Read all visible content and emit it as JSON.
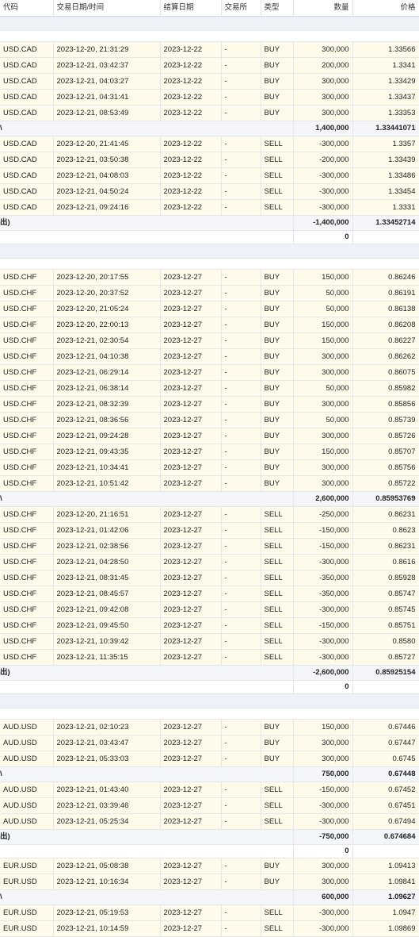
{
  "headers": [
    "代码",
    "交易日期/时间",
    "结算日期",
    "交易所",
    "类型",
    "数量",
    "价格"
  ],
  "groups": [
    {
      "buy_trades": [
        [
          "USD.CAD",
          "2023-12-20, 21:31:29",
          "2023-12-22",
          "-",
          "BUY",
          "300,000",
          "1.33566"
        ],
        [
          "USD.CAD",
          "2023-12-21, 03:42:37",
          "2023-12-22",
          "-",
          "BUY",
          "200,000",
          "1.3341"
        ],
        [
          "USD.CAD",
          "2023-12-21, 04:03:27",
          "2023-12-22",
          "-",
          "BUY",
          "300,000",
          "1.33429"
        ],
        [
          "USD.CAD",
          "2023-12-21, 04:31:41",
          "2023-12-22",
          "-",
          "BUY",
          "300,000",
          "1.33437"
        ],
        [
          "USD.CAD",
          "2023-12-21, 08:53:49",
          "2023-12-22",
          "-",
          "BUY",
          "300,000",
          "1.33353"
        ]
      ],
      "buy_total": {
        "label": "\\",
        "qty": "1,400,000",
        "price": "1.33441071"
      },
      "sell_trades": [
        [
          "USD.CAD",
          "2023-12-20, 21:41:45",
          "2023-12-22",
          "-",
          "SELL",
          "-300,000",
          "1.3357"
        ],
        [
          "USD.CAD",
          "2023-12-21, 03:50:38",
          "2023-12-22",
          "-",
          "SELL",
          "-200,000",
          "1.33439"
        ],
        [
          "USD.CAD",
          "2023-12-21, 04:08:03",
          "2023-12-22",
          "-",
          "SELL",
          "-300,000",
          "1.33486"
        ],
        [
          "USD.CAD",
          "2023-12-21, 04:50:24",
          "2023-12-22",
          "-",
          "SELL",
          "-300,000",
          "1.33454"
        ],
        [
          "USD.CAD",
          "2023-12-21, 09:24:16",
          "2023-12-22",
          "-",
          "SELL",
          "-300,000",
          "1.3331"
        ]
      ],
      "sell_total": {
        "label": "出)",
        "qty": "-1,400,000",
        "price": "1.33452714"
      },
      "net": "0"
    },
    {
      "buy_trades": [
        [
          "USD.CHF",
          "2023-12-20, 20:17:55",
          "2023-12-27",
          "-",
          "BUY",
          "150,000",
          "0.86246"
        ],
        [
          "USD.CHF",
          "2023-12-20, 20:37:52",
          "2023-12-27",
          "-",
          "BUY",
          "50,000",
          "0.86191"
        ],
        [
          "USD.CHF",
          "2023-12-20, 21:05:24",
          "2023-12-27",
          "-",
          "BUY",
          "50,000",
          "0.86138"
        ],
        [
          "USD.CHF",
          "2023-12-20, 22:00:13",
          "2023-12-27",
          "-",
          "BUY",
          "150,000",
          "0.86208"
        ],
        [
          "USD.CHF",
          "2023-12-21, 02:30:54",
          "2023-12-27",
          "-",
          "BUY",
          "150,000",
          "0.86227"
        ],
        [
          "USD.CHF",
          "2023-12-21, 04:10:38",
          "2023-12-27",
          "-",
          "BUY",
          "300,000",
          "0.86262"
        ],
        [
          "USD.CHF",
          "2023-12-21, 06:29:14",
          "2023-12-27",
          "-",
          "BUY",
          "300,000",
          "0.86075"
        ],
        [
          "USD.CHF",
          "2023-12-21, 06:38:14",
          "2023-12-27",
          "-",
          "BUY",
          "50,000",
          "0.85982"
        ],
        [
          "USD.CHF",
          "2023-12-21, 08:32:39",
          "2023-12-27",
          "-",
          "BUY",
          "300,000",
          "0.85856"
        ],
        [
          "USD.CHF",
          "2023-12-21, 08:36:56",
          "2023-12-27",
          "-",
          "BUY",
          "50,000",
          "0.85739"
        ],
        [
          "USD.CHF",
          "2023-12-21, 09:24:28",
          "2023-12-27",
          "-",
          "BUY",
          "300,000",
          "0.85726"
        ],
        [
          "USD.CHF",
          "2023-12-21, 09:43:35",
          "2023-12-27",
          "-",
          "BUY",
          "150,000",
          "0.85707"
        ],
        [
          "USD.CHF",
          "2023-12-21, 10:34:41",
          "2023-12-27",
          "-",
          "BUY",
          "300,000",
          "0.85756"
        ],
        [
          "USD.CHF",
          "2023-12-21, 10:51:42",
          "2023-12-27",
          "-",
          "BUY",
          "300,000",
          "0.85722"
        ]
      ],
      "buy_total": {
        "label": "\\",
        "qty": "2,600,000",
        "price": "0.85953769"
      },
      "sell_trades": [
        [
          "USD.CHF",
          "2023-12-20, 21:16:51",
          "2023-12-27",
          "-",
          "SELL",
          "-250,000",
          "0.86231"
        ],
        [
          "USD.CHF",
          "2023-12-21, 01:42:06",
          "2023-12-27",
          "-",
          "SELL",
          "-150,000",
          "0.8623"
        ],
        [
          "USD.CHF",
          "2023-12-21, 02:38:56",
          "2023-12-27",
          "-",
          "SELL",
          "-150,000",
          "0.86231"
        ],
        [
          "USD.CHF",
          "2023-12-21, 04:28:50",
          "2023-12-27",
          "-",
          "SELL",
          "-300,000",
          "0.8616"
        ],
        [
          "USD.CHF",
          "2023-12-21, 08:31:45",
          "2023-12-27",
          "-",
          "SELL",
          "-350,000",
          "0.85928"
        ],
        [
          "USD.CHF",
          "2023-12-21, 08:45:57",
          "2023-12-27",
          "-",
          "SELL",
          "-350,000",
          "0.85747"
        ],
        [
          "USD.CHF",
          "2023-12-21, 09:42:08",
          "2023-12-27",
          "-",
          "SELL",
          "-300,000",
          "0.85745"
        ],
        [
          "USD.CHF",
          "2023-12-21, 09:45:50",
          "2023-12-27",
          "-",
          "SELL",
          "-150,000",
          "0.85751"
        ],
        [
          "USD.CHF",
          "2023-12-21, 10:39:42",
          "2023-12-27",
          "-",
          "SELL",
          "-300,000",
          "0.8580"
        ],
        [
          "USD.CHF",
          "2023-12-21, 11:35:15",
          "2023-12-27",
          "-",
          "SELL",
          "-300,000",
          "0.85727"
        ]
      ],
      "sell_total": {
        "label": "出)",
        "qty": "-2,600,000",
        "price": "0.85925154"
      },
      "net": "0"
    },
    {
      "buy_trades": [
        [
          "AUD.USD",
          "2023-12-21, 02:10:23",
          "2023-12-27",
          "-",
          "BUY",
          "150,000",
          "0.67446"
        ],
        [
          "AUD.USD",
          "2023-12-21, 03:43:47",
          "2023-12-27",
          "-",
          "BUY",
          "300,000",
          "0.67447"
        ],
        [
          "AUD.USD",
          "2023-12-21, 05:33:03",
          "2023-12-27",
          "-",
          "BUY",
          "300,000",
          "0.6745"
        ]
      ],
      "buy_total": {
        "label": "\\",
        "qty": "750,000",
        "price": "0.67448"
      },
      "sell_trades": [
        [
          "AUD.USD",
          "2023-12-21, 01:43:40",
          "2023-12-27",
          "-",
          "SELL",
          "-150,000",
          "0.67452"
        ],
        [
          "AUD.USD",
          "2023-12-21, 03:39:46",
          "2023-12-27",
          "-",
          "SELL",
          "-300,000",
          "0.67451"
        ],
        [
          "AUD.USD",
          "2023-12-21, 05:25:34",
          "2023-12-27",
          "-",
          "SELL",
          "-300,000",
          "0.67494"
        ]
      ],
      "sell_total": {
        "label": "出)",
        "qty": "-750,000",
        "price": "0.674684"
      },
      "net": "0"
    },
    {
      "buy_trades": [
        [
          "EUR.USD",
          "2023-12-21, 05:08:38",
          "2023-12-27",
          "-",
          "BUY",
          "300,000",
          "1.09413"
        ],
        [
          "EUR.USD",
          "2023-12-21, 10:16:34",
          "2023-12-27",
          "-",
          "BUY",
          "300,000",
          "1.09841"
        ]
      ],
      "buy_total": {
        "label": "\\",
        "qty": "600,000",
        "price": "1.09627"
      },
      "sell_trades": [
        [
          "EUR.USD",
          "2023-12-21, 05:19:53",
          "2023-12-27",
          "-",
          "SELL",
          "-300,000",
          "1.0947"
        ],
        [
          "EUR.USD",
          "2023-12-21, 10:14:59",
          "2023-12-27",
          "-",
          "SELL",
          "-300,000",
          "1.09869"
        ]
      ]
    }
  ]
}
